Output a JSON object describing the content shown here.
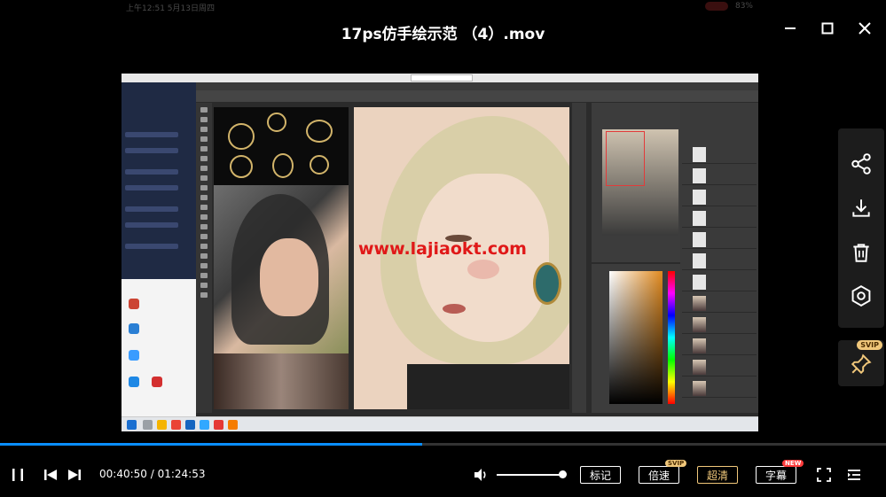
{
  "status": {
    "time_date": "上午12:51 5月13日周四",
    "battery": "83%"
  },
  "title": "17ps仿手绘示范 （4）.mov",
  "watermark": "www.lajiaokt.com",
  "player": {
    "current_time": "00:40:50",
    "total_time": "01:24:53",
    "time_sep": " / ",
    "progress_fraction": 0.476,
    "volume_fraction": 0.95,
    "buttons": {
      "bookmark": "标记",
      "speed": "倍速",
      "quality": "超清",
      "subtitle": "字幕"
    },
    "badges": {
      "speed": "SVIP",
      "subtitle": "NEW"
    }
  },
  "side_panel": {
    "pin_badge": "SVIP"
  },
  "icons": {
    "minimize": "minimize-icon",
    "maximize": "maximize-icon",
    "close": "close-icon",
    "share": "share-icon",
    "download": "download-icon",
    "delete": "trash-icon",
    "settings": "gear-icon",
    "pin": "pin-icon",
    "pause": "pause-icon",
    "prev": "skip-previous-icon",
    "next": "skip-next-icon",
    "volume": "volume-icon",
    "fullscreen": "fullscreen-icon",
    "playlist": "playlist-icon"
  },
  "colors": {
    "accent": "#0a8eff",
    "svip": "#f0c77a",
    "new": "#ff3b3b"
  }
}
